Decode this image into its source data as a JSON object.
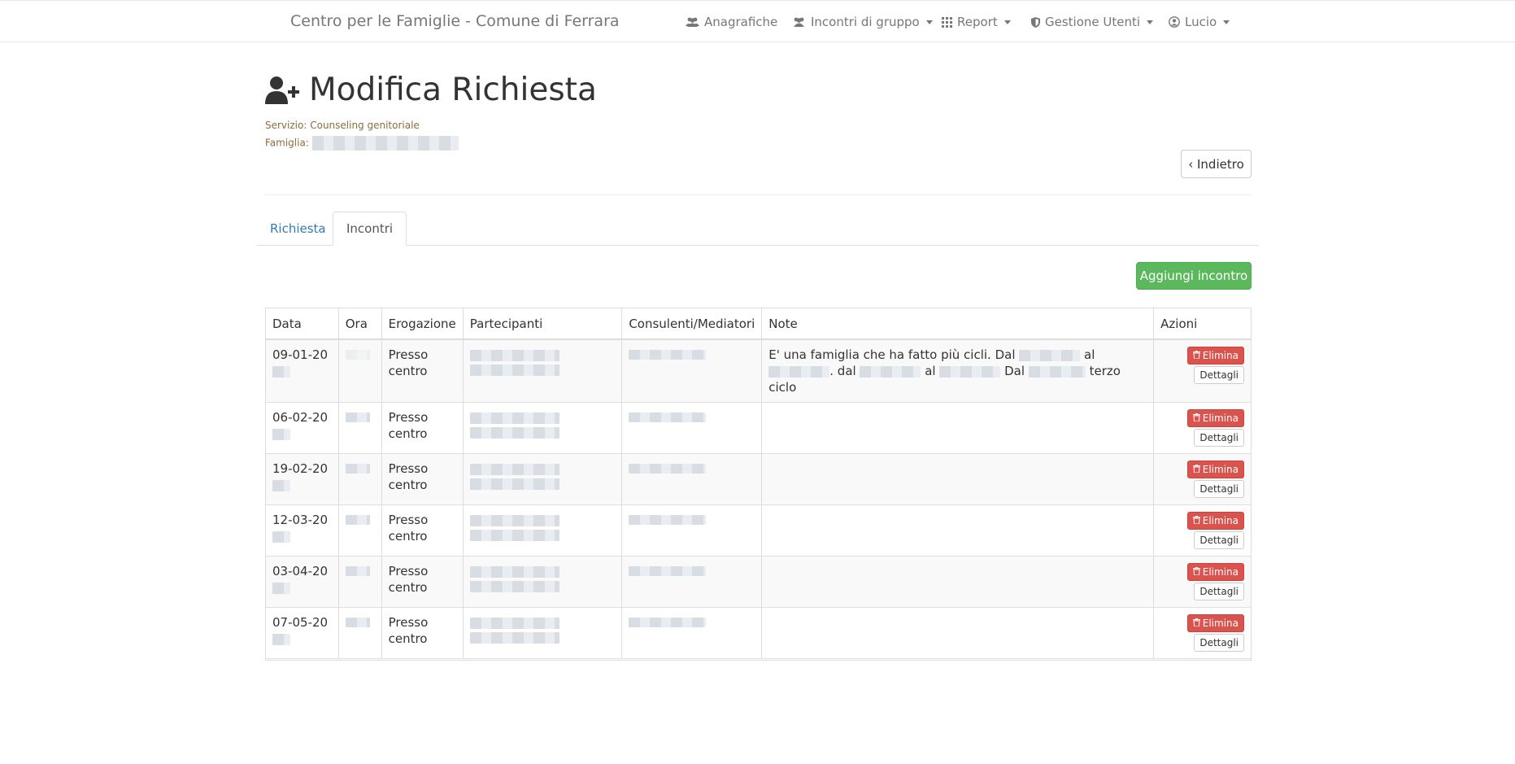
{
  "navbar": {
    "brand": "Centro per le Famiglie - Comune di Ferrara",
    "items": [
      {
        "label": "Anagrafiche",
        "icon": "users-icon",
        "dropdown": false
      },
      {
        "label": "Incontri di gruppo",
        "icon": "users-icon",
        "dropdown": true
      },
      {
        "label": "Report",
        "icon": "grid-icon",
        "dropdown": true
      },
      {
        "label": "Gestione Utenti",
        "icon": "shield-icon",
        "dropdown": true
      },
      {
        "label": "Lucio",
        "icon": "user-circle-icon",
        "dropdown": true
      }
    ]
  },
  "header": {
    "title": "Modifica Richiesta",
    "title_icon": "user-plus-icon",
    "servizio_label": "Servizio:",
    "servizio_value": "Counseling genitoriale",
    "famiglia_label": "Famiglia:",
    "back_button": "‹ Indietro"
  },
  "tabs": [
    {
      "label": "Richiesta",
      "active": false
    },
    {
      "label": "Incontri",
      "active": true
    }
  ],
  "add_button": "Aggiungi incontro",
  "table": {
    "columns": [
      "Data",
      "Ora",
      "Erogazione",
      "Partecipanti",
      "Consulenti/Mediatori",
      "Note",
      "Azioni"
    ],
    "rows": [
      {
        "data": "09-01-20",
        "erogazione": "Presso centro",
        "note_parts": [
          "E' una famiglia che ha fatto più cicli. Dal ",
          " al ",
          ". dal ",
          " al ",
          " Dal ",
          " terzo ciclo"
        ]
      },
      {
        "data": "06-02-20",
        "erogazione": "Presso centro",
        "note_parts": []
      },
      {
        "data": "19-02-20",
        "erogazione": "Presso centro",
        "note_parts": []
      },
      {
        "data": "12-03-20",
        "erogazione": "Presso centro",
        "note_parts": []
      },
      {
        "data": "03-04-20",
        "erogazione": "Presso centro",
        "note_parts": []
      },
      {
        "data": "07-05-20",
        "erogazione": "Presso centro",
        "note_parts": []
      }
    ],
    "delete_label": "Elimina",
    "details_label": "Dettagli"
  },
  "colors": {
    "link": "#337ab7",
    "success": "#5cb85c",
    "danger": "#d9534f",
    "meta_text": "#8a6d3b"
  }
}
